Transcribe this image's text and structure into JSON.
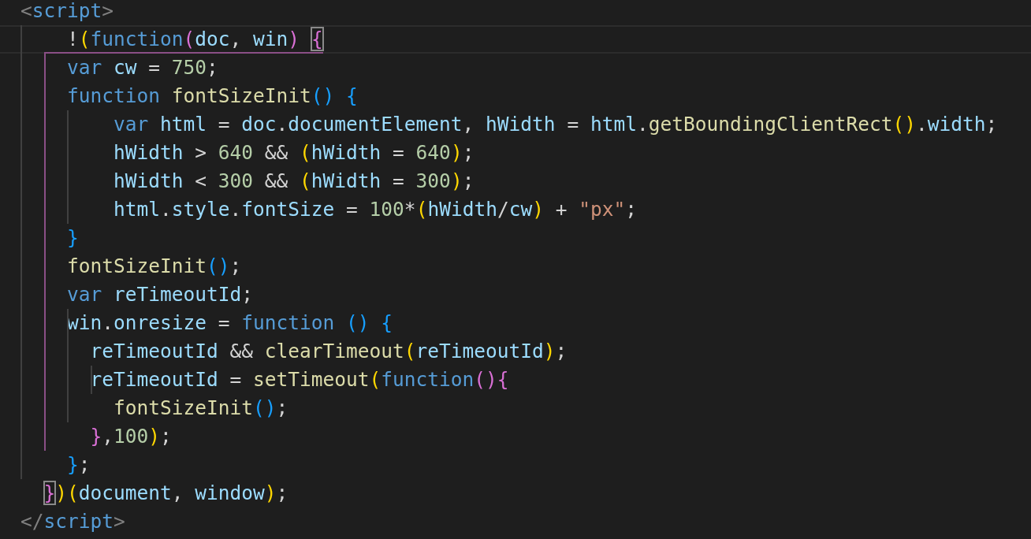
{
  "editor": {
    "lines": [
      {
        "current": false,
        "tokens": [
          {
            "text": "<",
            "kind": "tag"
          },
          {
            "text": "script",
            "kind": "tagname"
          },
          {
            "text": ">",
            "kind": "tag"
          }
        ]
      },
      {
        "current": true,
        "tokens": [
          {
            "text": "    !",
            "kind": "op"
          },
          {
            "text": "(",
            "kind": "y"
          },
          {
            "text": "function",
            "kind": "kw"
          },
          {
            "text": "(",
            "kind": "p"
          },
          {
            "text": "doc",
            "kind": "var"
          },
          {
            "text": ", ",
            "kind": "op"
          },
          {
            "text": "win",
            "kind": "var"
          },
          {
            "text": ") ",
            "kind": "p"
          },
          {
            "text": "{",
            "kind": "p",
            "matched": true
          }
        ]
      },
      {
        "current": false,
        "tokens": [
          {
            "text": "    var ",
            "kind": "kw"
          },
          {
            "text": "cw",
            "kind": "var"
          },
          {
            "text": " = ",
            "kind": "op"
          },
          {
            "text": "750",
            "kind": "num"
          },
          {
            "text": ";",
            "kind": "op"
          }
        ]
      },
      {
        "current": false,
        "tokens": [
          {
            "text": "    function ",
            "kind": "kw"
          },
          {
            "text": "fontSizeInit",
            "kind": "fn"
          },
          {
            "text": "() {",
            "kind": "b"
          }
        ]
      },
      {
        "current": false,
        "tokens": [
          {
            "text": "        var ",
            "kind": "kw"
          },
          {
            "text": "html",
            "kind": "var"
          },
          {
            "text": " = ",
            "kind": "op"
          },
          {
            "text": "doc",
            "kind": "var"
          },
          {
            "text": ".",
            "kind": "op"
          },
          {
            "text": "documentElement",
            "kind": "var"
          },
          {
            "text": ", ",
            "kind": "op"
          },
          {
            "text": "hWidth",
            "kind": "var"
          },
          {
            "text": " = ",
            "kind": "op"
          },
          {
            "text": "html",
            "kind": "var"
          },
          {
            "text": ".",
            "kind": "op"
          },
          {
            "text": "getBoundingClientRect",
            "kind": "fn"
          },
          {
            "text": "()",
            "kind": "y"
          },
          {
            "text": ".",
            "kind": "op"
          },
          {
            "text": "width",
            "kind": "var"
          },
          {
            "text": ";",
            "kind": "op"
          }
        ]
      },
      {
        "current": false,
        "tokens": [
          {
            "text": "        hWidth",
            "kind": "var"
          },
          {
            "text": " > ",
            "kind": "op"
          },
          {
            "text": "640",
            "kind": "num"
          },
          {
            "text": " && ",
            "kind": "op"
          },
          {
            "text": "(",
            "kind": "y"
          },
          {
            "text": "hWidth",
            "kind": "var"
          },
          {
            "text": " = ",
            "kind": "op"
          },
          {
            "text": "640",
            "kind": "num"
          },
          {
            "text": ")",
            "kind": "y"
          },
          {
            "text": ";",
            "kind": "op"
          }
        ]
      },
      {
        "current": false,
        "tokens": [
          {
            "text": "        hWidth",
            "kind": "var"
          },
          {
            "text": " < ",
            "kind": "op"
          },
          {
            "text": "300",
            "kind": "num"
          },
          {
            "text": " && ",
            "kind": "op"
          },
          {
            "text": "(",
            "kind": "y"
          },
          {
            "text": "hWidth",
            "kind": "var"
          },
          {
            "text": " = ",
            "kind": "op"
          },
          {
            "text": "300",
            "kind": "num"
          },
          {
            "text": ")",
            "kind": "y"
          },
          {
            "text": ";",
            "kind": "op"
          }
        ]
      },
      {
        "current": false,
        "tokens": [
          {
            "text": "        html",
            "kind": "var"
          },
          {
            "text": ".",
            "kind": "op"
          },
          {
            "text": "style",
            "kind": "var"
          },
          {
            "text": ".",
            "kind": "op"
          },
          {
            "text": "fontSize",
            "kind": "var"
          },
          {
            "text": " = ",
            "kind": "op"
          },
          {
            "text": "100",
            "kind": "num"
          },
          {
            "text": "*",
            "kind": "op"
          },
          {
            "text": "(",
            "kind": "y"
          },
          {
            "text": "hWidth",
            "kind": "var"
          },
          {
            "text": "/",
            "kind": "op"
          },
          {
            "text": "cw",
            "kind": "var"
          },
          {
            "text": ")",
            "kind": "y"
          },
          {
            "text": " + ",
            "kind": "op"
          },
          {
            "text": "\"px\"",
            "kind": "str"
          },
          {
            "text": ";",
            "kind": "op"
          }
        ]
      },
      {
        "current": false,
        "tokens": [
          {
            "text": "    }",
            "kind": "b"
          }
        ]
      },
      {
        "current": false,
        "tokens": [
          {
            "text": "    fontSizeInit",
            "kind": "fn"
          },
          {
            "text": "()",
            "kind": "b"
          },
          {
            "text": ";",
            "kind": "op"
          }
        ]
      },
      {
        "current": false,
        "tokens": [
          {
            "text": "    var ",
            "kind": "kw"
          },
          {
            "text": "reTimeoutId",
            "kind": "var"
          },
          {
            "text": ";",
            "kind": "op"
          }
        ]
      },
      {
        "current": false,
        "tokens": [
          {
            "text": "    win",
            "kind": "var"
          },
          {
            "text": ".",
            "kind": "op"
          },
          {
            "text": "onresize",
            "kind": "var"
          },
          {
            "text": " = ",
            "kind": "op"
          },
          {
            "text": "function ",
            "kind": "kw"
          },
          {
            "text": "() {",
            "kind": "b"
          }
        ]
      },
      {
        "current": false,
        "tokens": [
          {
            "text": "      reTimeoutId",
            "kind": "var"
          },
          {
            "text": " && ",
            "kind": "op"
          },
          {
            "text": "clearTimeout",
            "kind": "fn"
          },
          {
            "text": "(",
            "kind": "y"
          },
          {
            "text": "reTimeoutId",
            "kind": "var"
          },
          {
            "text": ")",
            "kind": "y"
          },
          {
            "text": ";",
            "kind": "op"
          }
        ]
      },
      {
        "current": false,
        "tokens": [
          {
            "text": "      reTimeoutId",
            "kind": "var"
          },
          {
            "text": " = ",
            "kind": "op"
          },
          {
            "text": "setTimeout",
            "kind": "fn"
          },
          {
            "text": "(",
            "kind": "y"
          },
          {
            "text": "function",
            "kind": "kw"
          },
          {
            "text": "(){",
            "kind": "p"
          }
        ]
      },
      {
        "current": false,
        "tokens": [
          {
            "text": "        fontSizeInit",
            "kind": "fn"
          },
          {
            "text": "()",
            "kind": "b"
          },
          {
            "text": ";",
            "kind": "op"
          }
        ]
      },
      {
        "current": false,
        "tokens": [
          {
            "text": "      }",
            "kind": "p"
          },
          {
            "text": ",",
            "kind": "op"
          },
          {
            "text": "100",
            "kind": "num"
          },
          {
            "text": ")",
            "kind": "y"
          },
          {
            "text": ";",
            "kind": "op"
          }
        ]
      },
      {
        "current": false,
        "tokens": [
          {
            "text": "    }",
            "kind": "b"
          },
          {
            "text": ";",
            "kind": "op"
          }
        ]
      },
      {
        "current": false,
        "tokens": [
          {
            "text": "  }",
            "kind": "p",
            "matched": true
          },
          {
            "text": ")(",
            "kind": "y"
          },
          {
            "text": "document",
            "kind": "var"
          },
          {
            "text": ", ",
            "kind": "op"
          },
          {
            "text": "window",
            "kind": "var"
          },
          {
            "text": ")",
            "kind": "y"
          },
          {
            "text": ";",
            "kind": "op"
          }
        ]
      },
      {
        "current": false,
        "tokens": [
          {
            "text": "</",
            "kind": "tag"
          },
          {
            "text": "script",
            "kind": "tagname"
          },
          {
            "text": ">",
            "kind": "tag"
          }
        ]
      }
    ]
  }
}
